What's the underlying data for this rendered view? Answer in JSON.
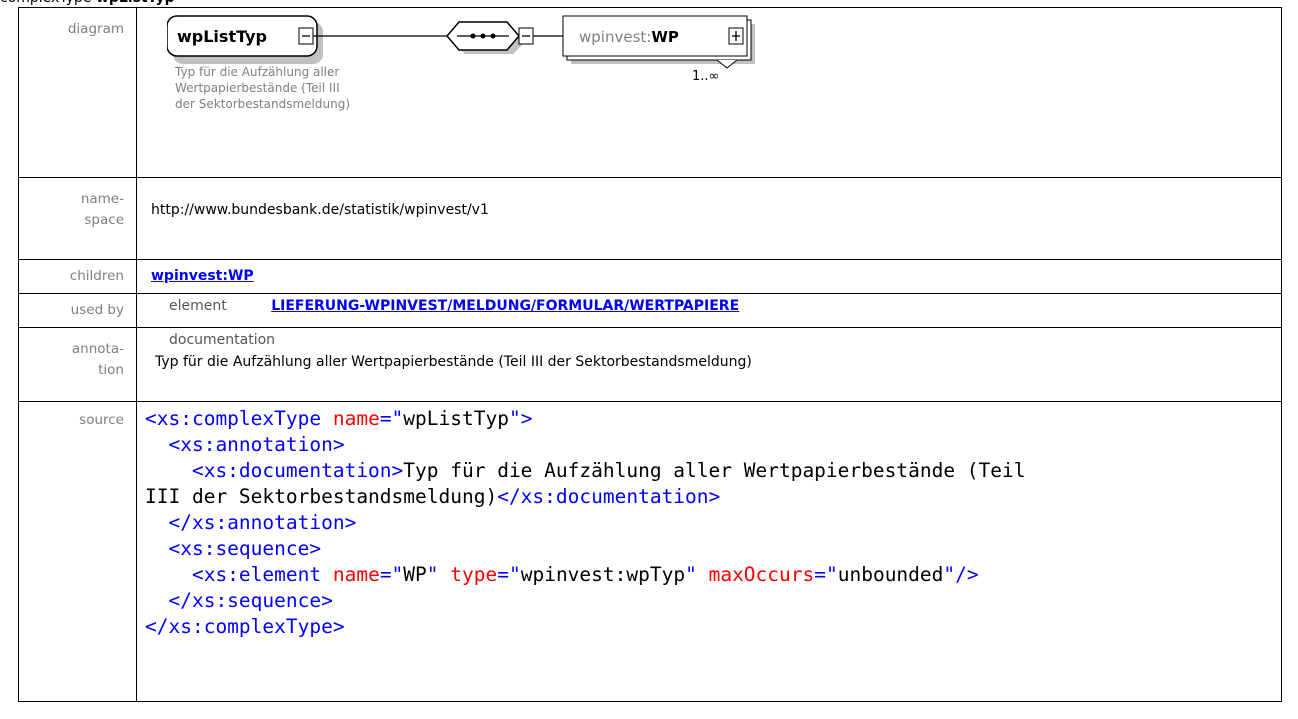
{
  "header": {
    "prefix": "complexType",
    "name": "wpListTyp"
  },
  "labels": {
    "diagram": "diagram",
    "namespace_1": "name-",
    "namespace_2": "space",
    "children": "children",
    "used_by": "used by",
    "annotation_1": "annota-",
    "annotation_2": "tion",
    "source": "source"
  },
  "diagram": {
    "type_name": "wpListTyp",
    "collapse_symbol": "⊟",
    "description_lines": [
      "Typ für die Aufzählung aller",
      "Wertpapierbestände (Teil III",
      "der Sektorbestandsmeldung)"
    ],
    "element_prefix": "wpinvest:",
    "element_name": "WP",
    "occurrence": "1..∞"
  },
  "namespace": "http://www.bundesbank.de/statistik/wpinvest/v1",
  "children": [
    "wpinvest:WP"
  ],
  "used_by": {
    "kind": "element",
    "path": "LIEFERUNG-WPINVEST/MELDUNG/FORMULAR/WERTPAPIERE"
  },
  "annotation": {
    "heading": "documentation",
    "text": "Typ für die Aufzählung aller Wertpapierbestände (Teil III der Sektorbestandsmeldung)"
  },
  "source": {
    "l1_open": "<xs:complexType",
    "l1_attr": " name",
    "l1_eq": "=\"",
    "l1_val": "wpListTyp",
    "l1_close": "\">",
    "l2": "  <xs:annotation>",
    "l3_open": "    <xs:documentation>",
    "l3_text": "Typ für die Aufzählung aller Wertpapierbestände (Teil",
    "l4_text": "III der Sektorbestandsmeldung)",
    "l4_close": "</xs:documentation>",
    "l5": "  </xs:annotation>",
    "l6": "  <xs:sequence>",
    "l7_open": "    <xs:element",
    "l7_a1": " name",
    "l7_eq1": "=\"",
    "l7_v1": "WP",
    "l7_q1": "\"",
    "l7_a2": " type",
    "l7_eq2": "=\"",
    "l7_v2": "wpinvest:wpTyp",
    "l7_q2": "\"",
    "l7_a3": " maxOccurs",
    "l7_eq3": "=\"",
    "l7_v3": "unbounded",
    "l7_close": "\"/>",
    "l8": "  </xs:sequence>",
    "l9": "</xs:complexType>"
  }
}
